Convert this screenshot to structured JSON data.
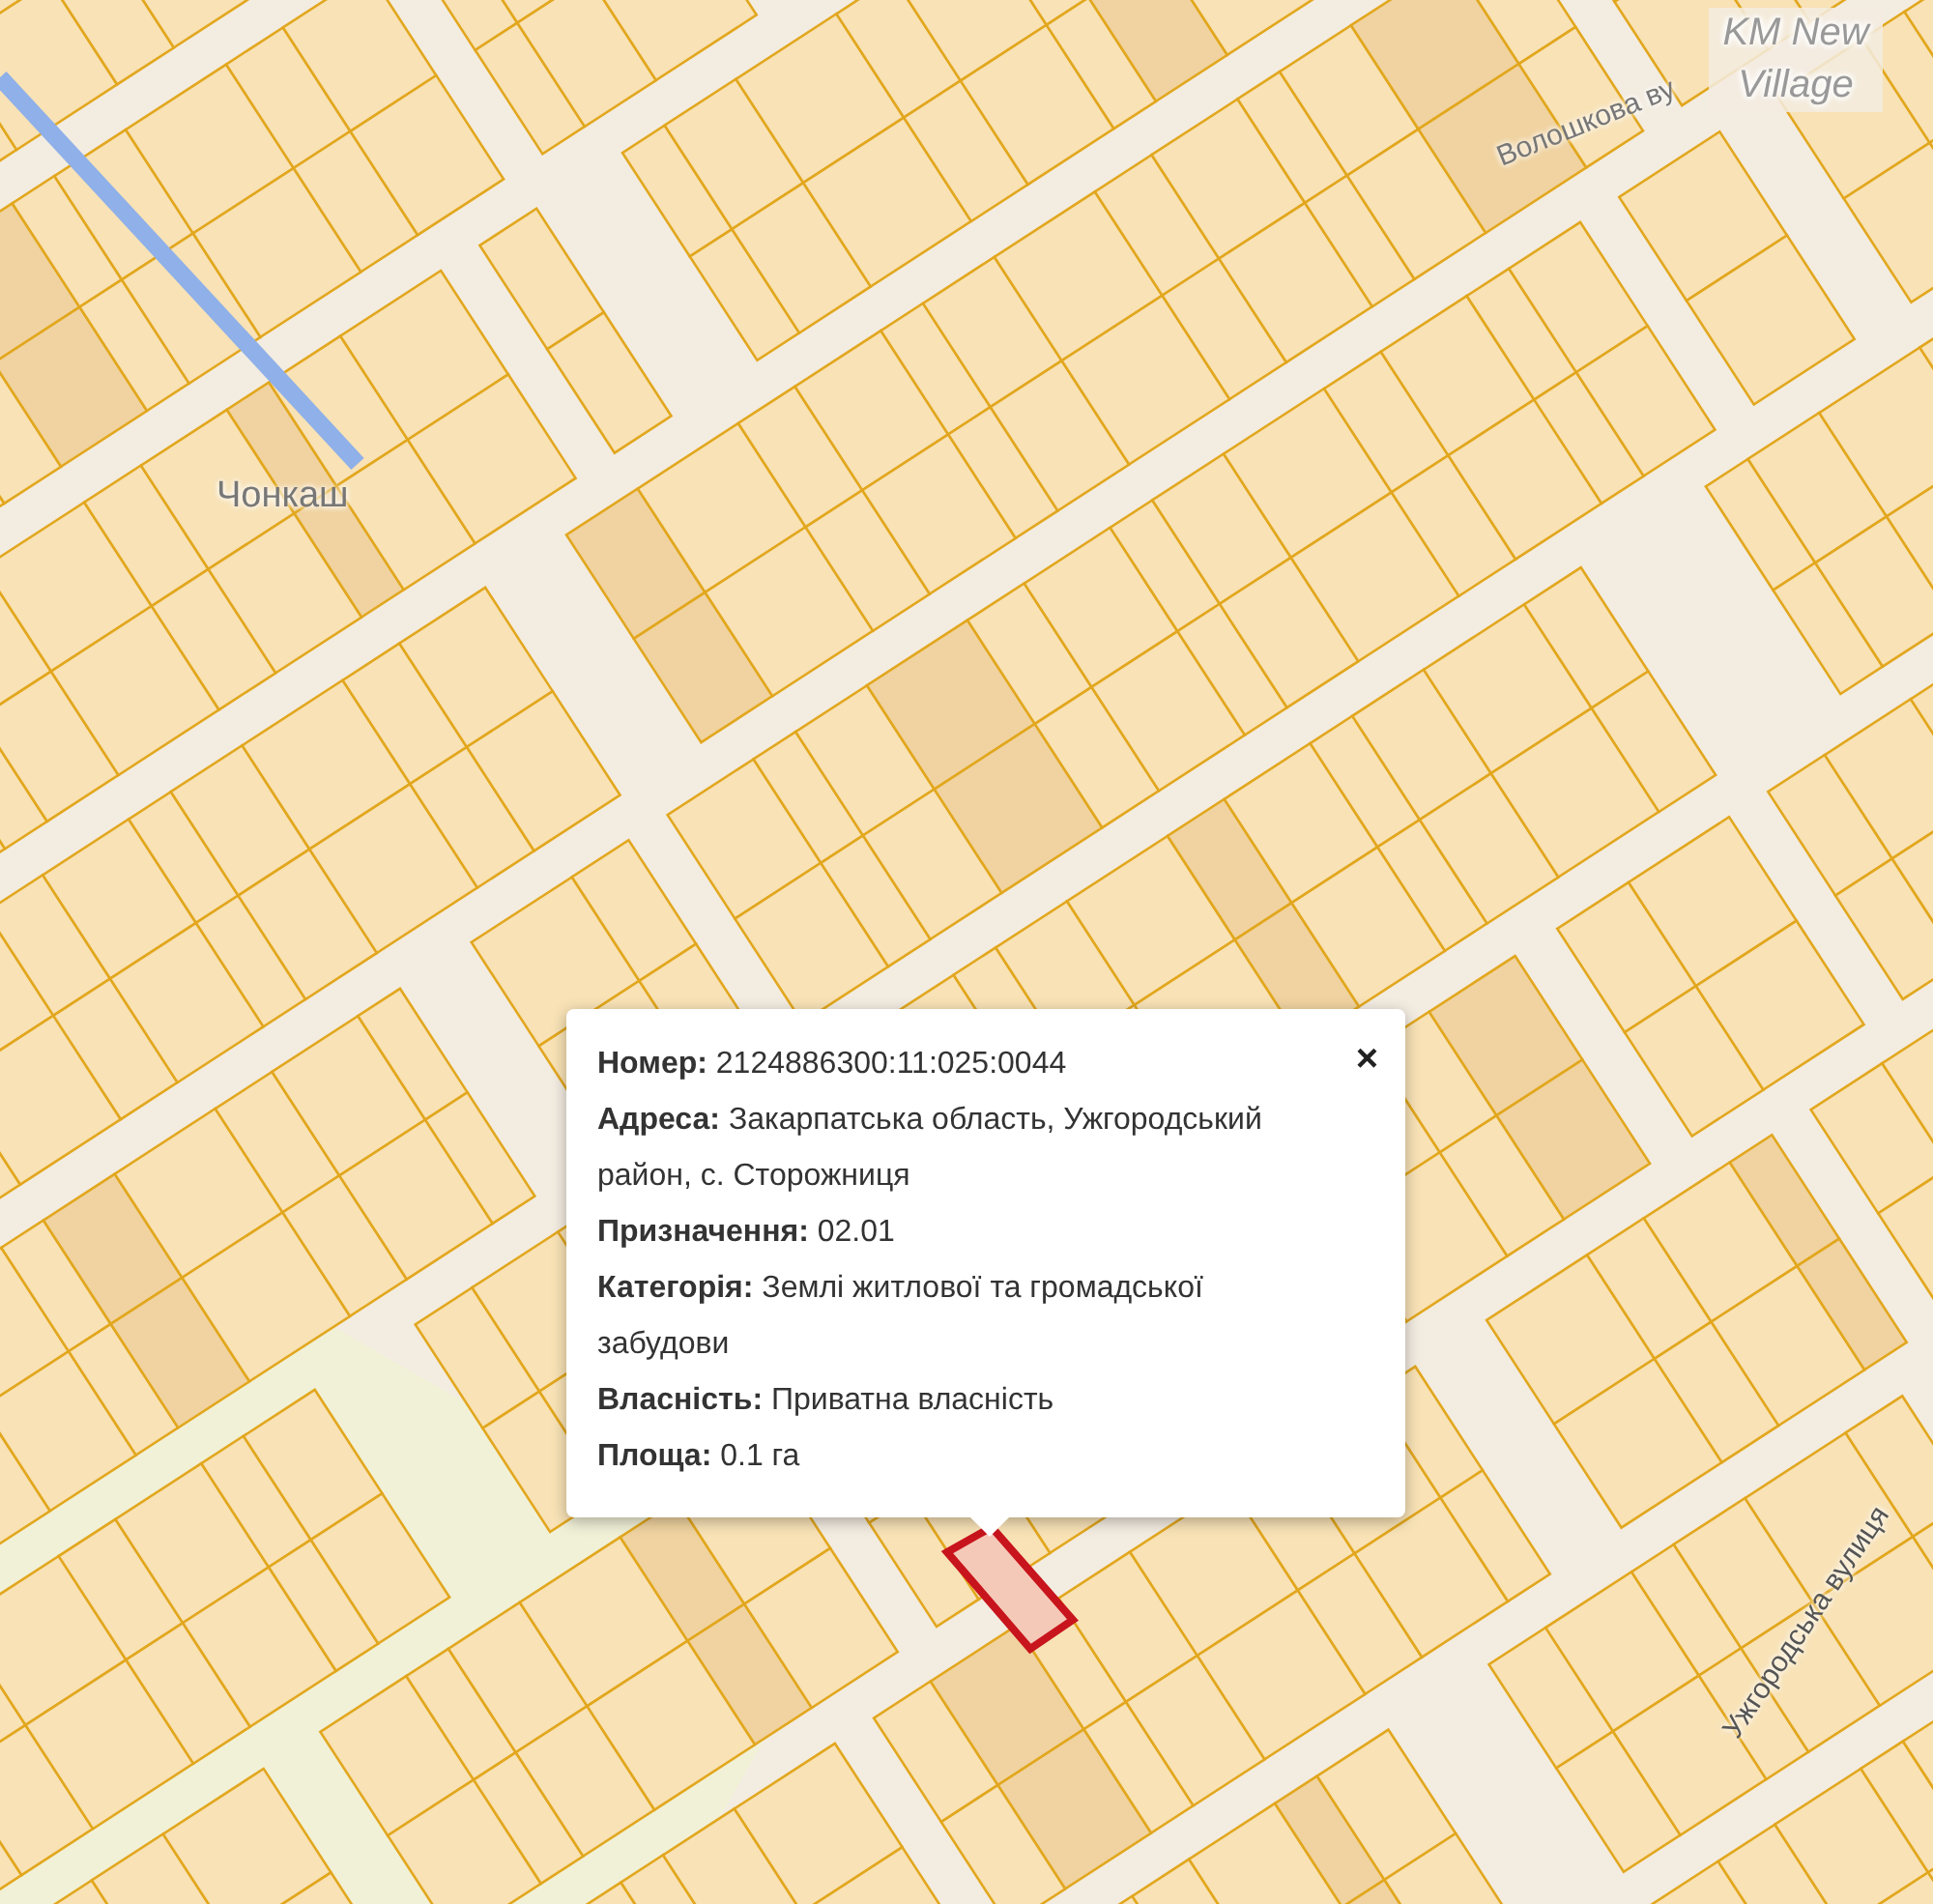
{
  "map": {
    "labels": [
      {
        "text": "Чонкаш",
        "kind": "place"
      },
      {
        "text": "Волошкова ву",
        "kind": "street"
      },
      {
        "text": "KM New Village",
        "kind": "district"
      },
      {
        "text": "Ужгородська вулиця",
        "kind": "street2"
      }
    ]
  },
  "popup": {
    "close": "×",
    "rows": [
      "**Номер:** 2124886300:11:025:0044",
      "**Адреса:** Закарпатська область, Ужгородський район, с. Сторожниця",
      "**Призначення:** 02.01",
      "**Категорія:** Землі житлової та громадської забудови",
      "**Власність:** Приватна власність",
      "**Площа:** 0.1 га"
    ]
  }
}
